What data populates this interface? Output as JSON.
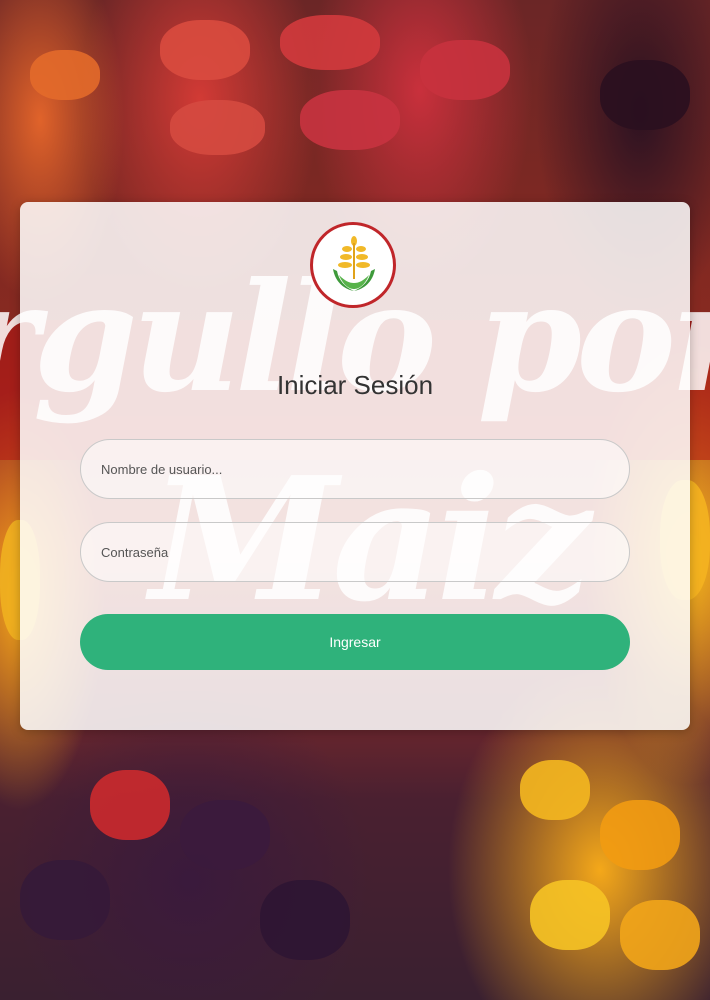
{
  "background": {
    "watermark_line1": "rgullo por",
    "watermark_line2": "Maiz"
  },
  "login": {
    "title": "Iniciar Sesión",
    "username_placeholder": "Nombre de usuario...",
    "password_placeholder": "Contraseña",
    "submit_label": "Ingresar",
    "logo_icon": "wheat-hands-logo-icon"
  },
  "colors": {
    "accent_button": "#2fb27b",
    "logo_border": "#c0262a",
    "logo_grain": "#f1b928",
    "logo_hands": "#3e9a3b"
  }
}
